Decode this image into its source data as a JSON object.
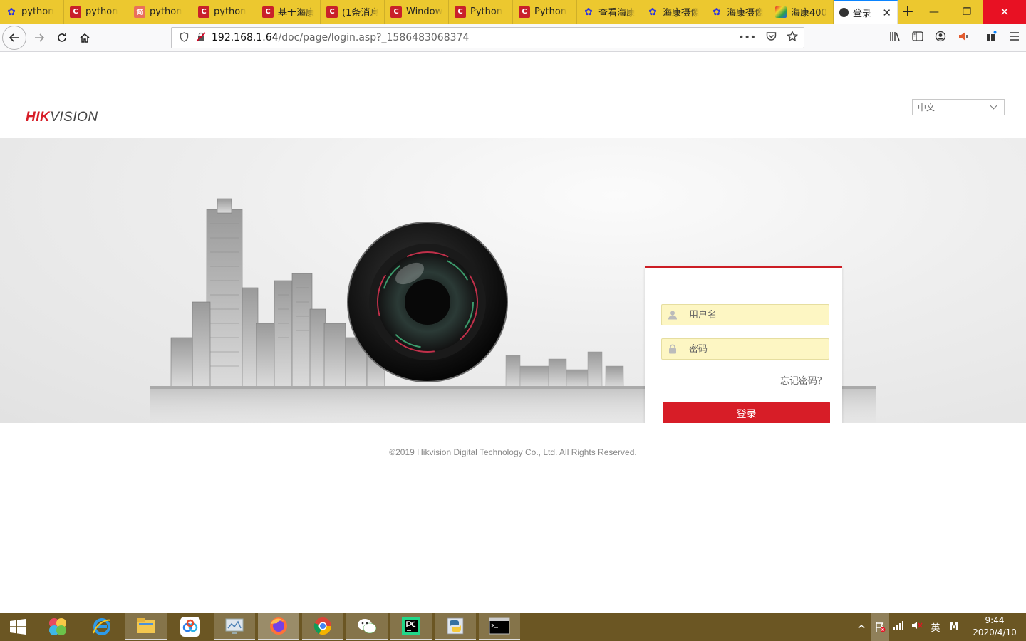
{
  "tabs": [
    {
      "label": "python",
      "favicon": "baidu-paw-icon"
    },
    {
      "label": "python",
      "favicon": "csdn-icon"
    },
    {
      "label": "python",
      "favicon": "jianshu-icon"
    },
    {
      "label": "python",
      "favicon": "csdn-icon"
    },
    {
      "label": "基于海康",
      "favicon": "csdn-icon"
    },
    {
      "label": "(1条消息",
      "favicon": "csdn-icon"
    },
    {
      "label": "Window",
      "favicon": "csdn-icon"
    },
    {
      "label": "Python",
      "favicon": "csdn-icon"
    },
    {
      "label": "Python",
      "favicon": "csdn-icon"
    },
    {
      "label": "查看海康",
      "favicon": "baidu-paw-icon"
    },
    {
      "label": "海康摄像",
      "favicon": "baidu-paw-icon"
    },
    {
      "label": "海康摄像",
      "favicon": "baidu-paw-icon"
    },
    {
      "label": "海康400",
      "favicon": "rainbow-icon"
    },
    {
      "label": "登录",
      "favicon": "camera-icon",
      "active": true
    }
  ],
  "jianshu_glyph": "简",
  "new_tab_glyph": "+",
  "window_controls": {
    "minimize": "—",
    "restore": "❐",
    "close": "✕"
  },
  "urlbar": {
    "host": "192.168.1.64",
    "path": "/doc/page/login.asp?_1586483068374",
    "actions_glyph": "•••"
  },
  "page": {
    "logo_bold": "HIK",
    "logo_rest": "VISION",
    "language": "中文",
    "username_placeholder": "用户名",
    "password_placeholder": "密码",
    "forgot_password": "忘记密码？",
    "login_button": "登录",
    "copyright": "©2019 Hikvision Digital Technology Co., Ltd. All Rights Reserved."
  },
  "colors": {
    "brand_red": "#d71d27",
    "tabstrip": "#ecc82f",
    "taskbar": "#6b5623",
    "input_bg": "#fdf6c3"
  },
  "taskbar": {
    "apps": [
      "start-icon",
      "app-pinwheel-icon",
      "internet-explorer-icon",
      "file-explorer-icon",
      "baidu-netdisk-icon",
      "screen-monitor-icon",
      "firefox-icon",
      "chrome-icon",
      "wechat-icon",
      "pycharm-icon",
      "python-icon",
      "cmd-icon"
    ],
    "ime": "英",
    "ime_mode": "M",
    "time": "9:44",
    "date": "2020/4/10"
  }
}
